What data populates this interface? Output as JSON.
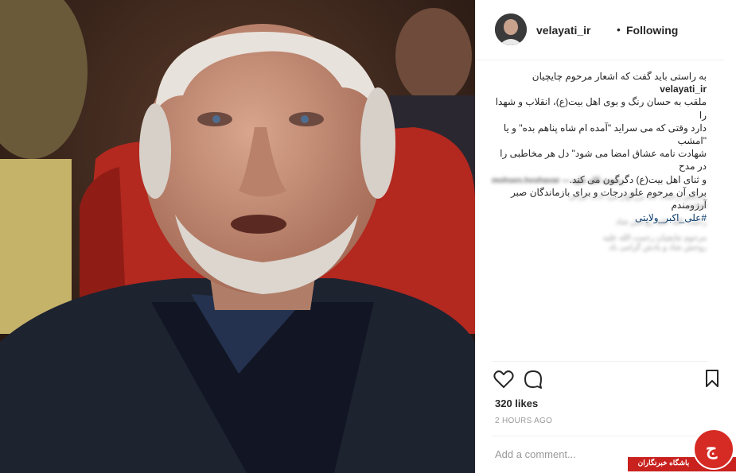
{
  "post": {
    "photo_alt": "portrait photo",
    "username": "velayati_ir",
    "dot": "•",
    "follow_status": "Following",
    "caption_user": "velayati_ir",
    "caption_lines": [
      "به راستی باید گفت که اشعار مرحوم چایچیان",
      "ملقب به حسان رنگ و بوی اهل بیت(ع)، انقلاب و شهدا را",
      "دارد وقتی که می سراید \"آمده ام شاه پناهم بده\" و یا \"امشب",
      "شهادت نامه عشاق امضا می شود\" دل هر مخاطبی را در مدح",
      "و ثنای اهل بیت(ع) دگرگون می کند.",
      "برای آن مرحوم علو درجات و برای بازماندگان صبر آرزومندم"
    ],
    "hashtag": "#علی_اکبر_ولایتی",
    "blurred_comments": [
      "mohsen.hoshavar — رحمت الله علیه",
      "خدایش رحمت کند بزرگوار مرد ادب ایرانی",
      "الفاتحه",
      "رحمت الله علیه روحش شاد",
      "مرحوم چایچیان رحمت الله علیه",
      "روحش شاد و یادش گرامی باد"
    ],
    "likes": "320 likes",
    "time": "2 HOURS AGO",
    "add_comment_placeholder": "Add a comment..."
  },
  "watermark": {
    "text": "باشگاه خبرنگاران",
    "logo_glyph": "ج",
    "color": "#c8211e"
  },
  "icons": [
    "heart-icon",
    "comment-icon",
    "bookmark-icon"
  ]
}
